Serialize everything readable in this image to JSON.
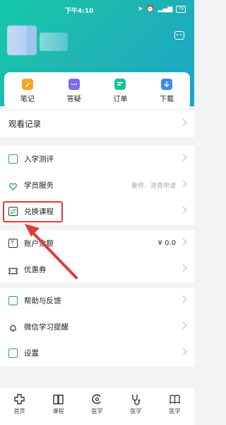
{
  "status": {
    "time": "下午4:10",
    "battery": "79"
  },
  "quick": [
    {
      "label": "笔记",
      "color": "#f5a623"
    },
    {
      "label": "答疑",
      "color": "#7b6cf6"
    },
    {
      "label": "订单",
      "color": "#16c29a"
    },
    {
      "label": "下载",
      "color": "#3d8bfd"
    }
  ],
  "history": {
    "label": "观看记录"
  },
  "section1": [
    {
      "label": "入学测评"
    },
    {
      "label": "学员服务",
      "sub": "重修、退费申请"
    },
    {
      "label": "兑换课程"
    }
  ],
  "section2": [
    {
      "label": "账户余额",
      "value": "¥ 0.0"
    },
    {
      "label": "优惠券"
    }
  ],
  "section3": [
    {
      "label": "帮助与反馈"
    },
    {
      "label": "微信学习提醒"
    },
    {
      "label": "设置"
    }
  ],
  "tabs": [
    {
      "label": "首页"
    },
    {
      "label": "课程"
    },
    {
      "label": "医学"
    },
    {
      "label": "医学"
    },
    {
      "label": "医学"
    }
  ],
  "colors": {
    "header_start": "#14c9a8",
    "header_end": "#1aa5c8",
    "highlight": "#e53935",
    "accent": "#2ea36c"
  }
}
